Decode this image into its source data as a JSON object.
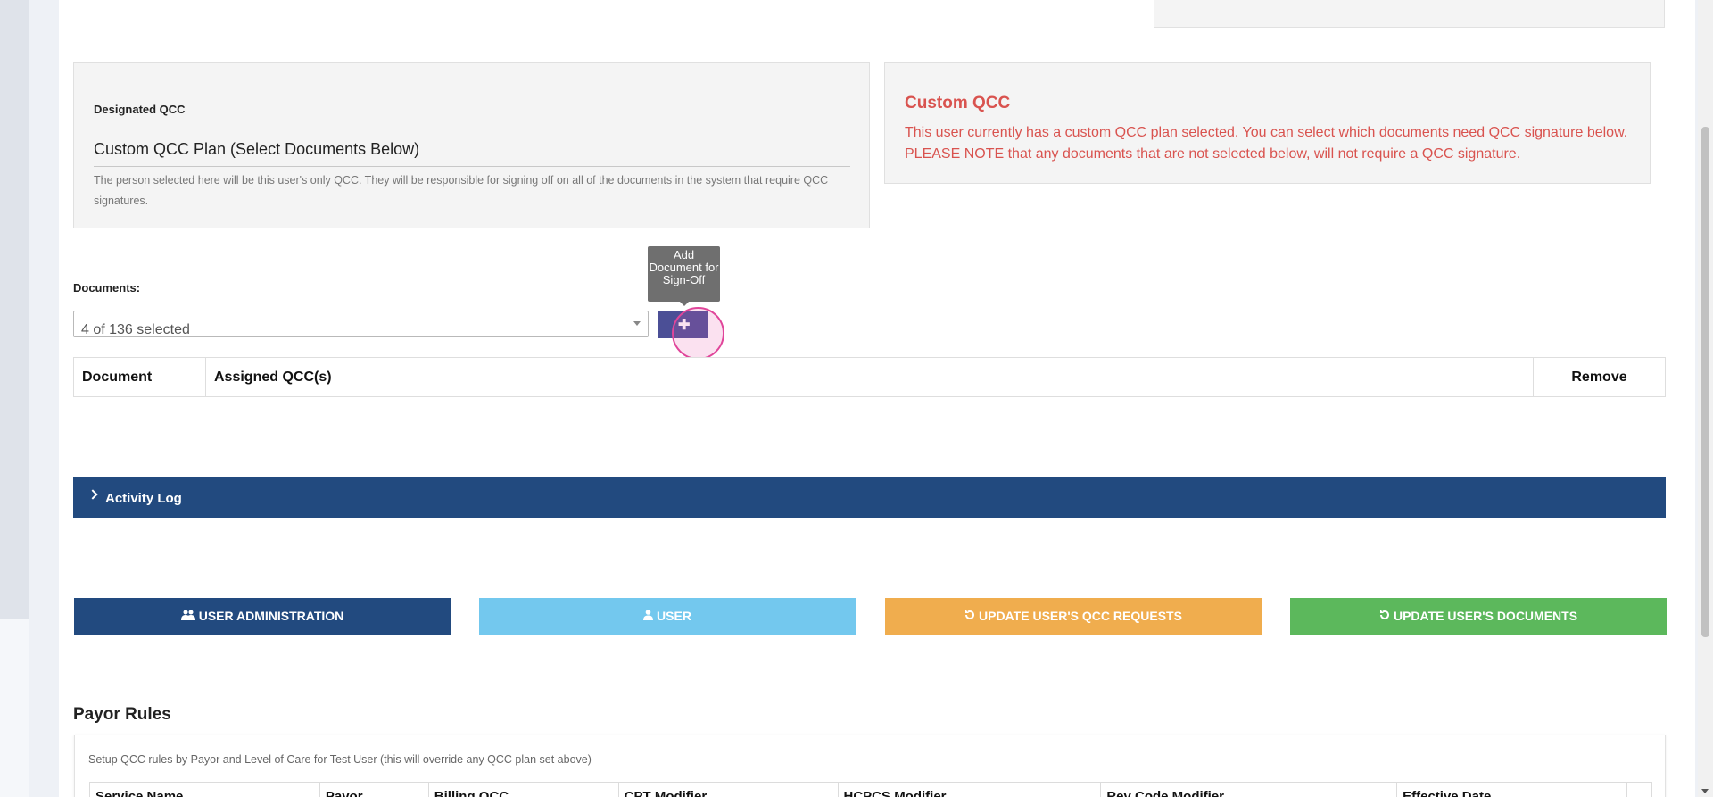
{
  "qcc_panel": {
    "label": "Designated QCC",
    "selected_plan": "Custom QCC Plan (Select Documents Below)",
    "help_text": "The person selected here will be this user's only QCC. They will be responsible for signing off on all of the documents in the system that require QCC signatures."
  },
  "custom_panel": {
    "title": "Custom QCC",
    "message": "This user currently has a custom QCC plan selected. You can select which documents need QCC signature below. PLEASE NOTE that any documents that are not selected below, will not require a QCC signature."
  },
  "documents": {
    "label": "Documents:",
    "selected_value": "4 of 136 selected",
    "add_tooltip": "Add Document for Sign-Off",
    "add_button_icon": "plus-icon",
    "add_button_glyph": "✚",
    "table_headers": {
      "document": "Document",
      "assigned": "Assigned QCC(s)",
      "remove": "Remove"
    }
  },
  "activity_log": {
    "label": "Activity Log"
  },
  "actions": {
    "admin": {
      "label": "USER ADMINISTRATION",
      "icon": "users-icon"
    },
    "user": {
      "label": "USER",
      "icon": "user-icon"
    },
    "qcc_requests": {
      "label": "UPDATE USER'S QCC REQUESTS",
      "icon": "refresh-icon"
    },
    "documents": {
      "label": "UPDATE USER'S DOCUMENTS",
      "icon": "refresh-icon"
    }
  },
  "payor_rules": {
    "title": "Payor Rules",
    "description": "Setup QCC rules by Payor and Level of Care for Test User (this will override any QCC plan set above)",
    "headers": [
      "Service Name",
      "Payor",
      "Billing QCC",
      "CPT Modifier",
      "HCPCS Modifier",
      "Rev Code Modifier",
      "Effective Date"
    ]
  },
  "colors": {
    "primary": "#224a7f",
    "info": "#73c8ee",
    "warning": "#f0ad4e",
    "success": "#5cb85c",
    "danger": "#d9534f"
  }
}
